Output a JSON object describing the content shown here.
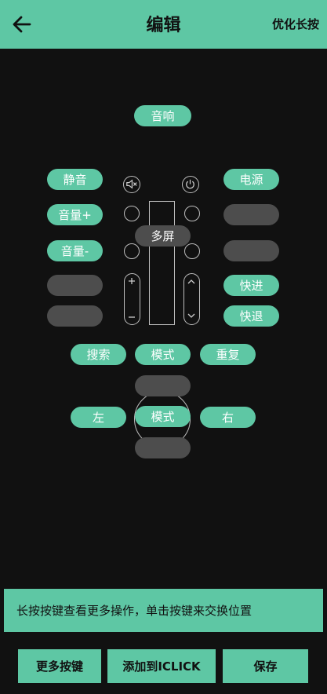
{
  "header": {
    "title": "编辑",
    "action": "优化长按"
  },
  "remote": {
    "audio": "音响",
    "mute": "静音",
    "power": "电源",
    "vol_up": "音量+",
    "vol_down": "音量-",
    "multi_screen": "多屏",
    "fast_forward": "快进",
    "rewind": "快退",
    "search": "搜索",
    "mode": "模式",
    "repeat": "重复",
    "left": "左",
    "right": "右",
    "mode2": "模式"
  },
  "hint": "长按按键查看更多操作，单击按键来交换位置",
  "bottom": {
    "more": "更多按键",
    "add": "添加到ICLICK",
    "save": "保存"
  },
  "colors": {
    "accent": "#5ec7a4",
    "background": "#111111",
    "empty_key": "#4d4d4d"
  }
}
